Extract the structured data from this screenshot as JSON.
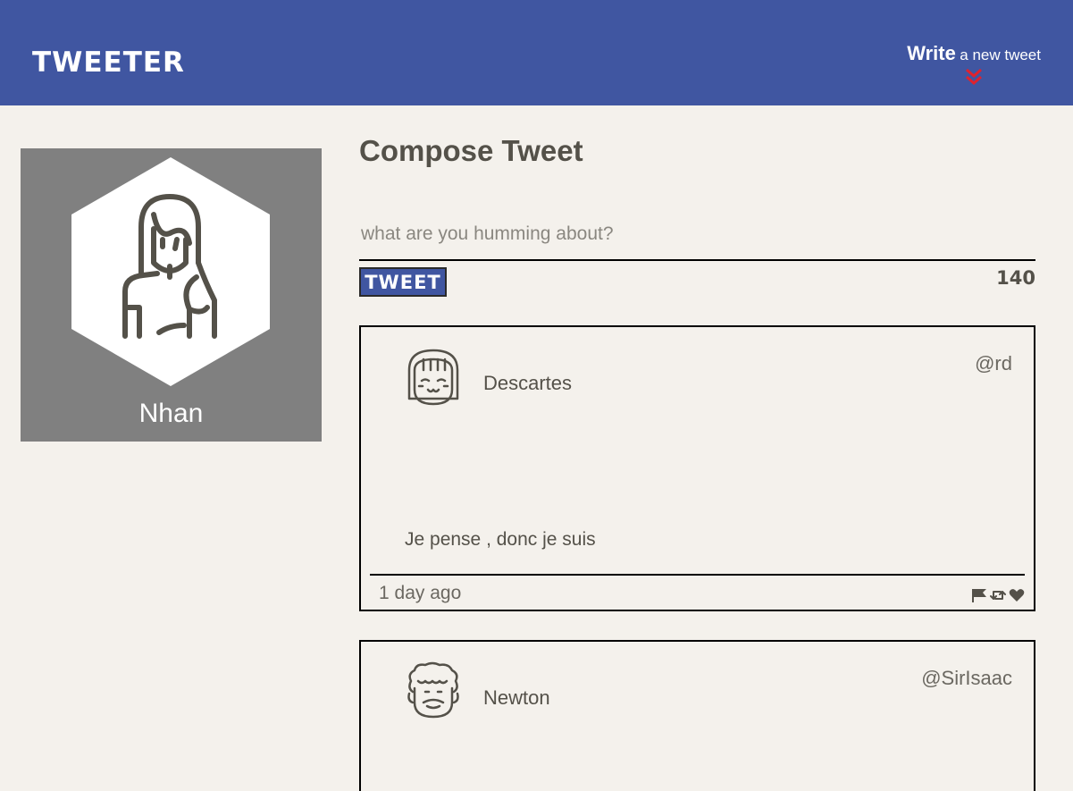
{
  "nav": {
    "brand": "TWEETER",
    "compose_strong": "Write",
    "compose_rest": "a new tweet"
  },
  "profile": {
    "name": "Nhan"
  },
  "compose": {
    "title": "Compose Tweet",
    "placeholder": "what are you humming about?",
    "button_label": "TWEET",
    "counter": "140"
  },
  "tweets": [
    {
      "name": "Descartes",
      "handle": "@rd",
      "content": "Je pense , donc je suis",
      "time": "1 day ago",
      "icons": [
        "flag-icon",
        "retweet-icon",
        "heart-icon"
      ]
    },
    {
      "name": "Newton",
      "handle": "@SirIsaac"
    }
  ],
  "colors": {
    "nav_bg": "#4056a1",
    "page_bg": "#f4f1ec",
    "profile_bg": "#808080",
    "chevron": "#e0222e",
    "text": "#545149"
  }
}
